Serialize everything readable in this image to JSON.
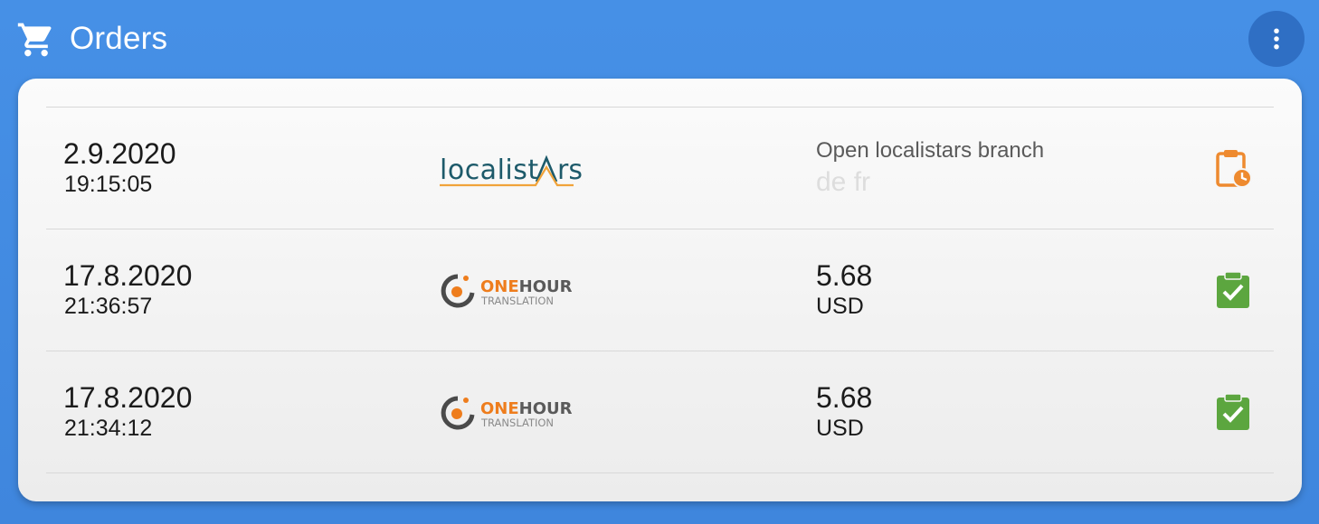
{
  "header": {
    "icon": "shopping-cart-icon",
    "title": "Orders",
    "menu_icon": "more-vertical-icon"
  },
  "colors": {
    "background": "#4690e6",
    "pending": "#ee8a2f",
    "completed": "#5ca63f"
  },
  "orders": [
    {
      "date": "2.9.2020",
      "time": "19:15:05",
      "provider_logo": "localistars",
      "description": "Open localistars branch",
      "languages": "de fr",
      "status": "pending",
      "status_icon": "clipboard-clock-icon"
    },
    {
      "date": "17.8.2020",
      "time": "21:36:57",
      "provider_logo": "onehour-translation",
      "provider_line1_a": "ONE",
      "provider_line1_b": "HOUR",
      "provider_line2": "TRANSLATION",
      "amount": "5.68",
      "currency": "USD",
      "status": "completed",
      "status_icon": "clipboard-check-icon"
    },
    {
      "date": "17.8.2020",
      "time": "21:34:12",
      "provider_logo": "onehour-translation",
      "provider_line1_a": "ONE",
      "provider_line1_b": "HOUR",
      "provider_line2": "TRANSLATION",
      "amount": "5.68",
      "currency": "USD",
      "status": "completed",
      "status_icon": "clipboard-check-icon"
    }
  ]
}
